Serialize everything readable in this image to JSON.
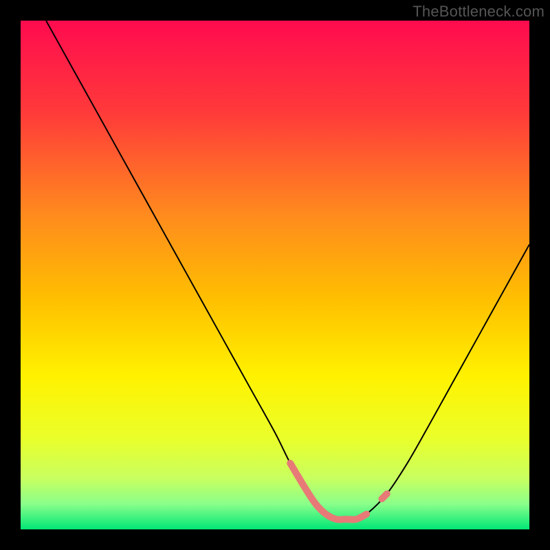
{
  "watermark": "TheBottleneck.com",
  "chart_data": {
    "type": "line",
    "title": "",
    "xlabel": "",
    "ylabel": "",
    "xlim": [
      0,
      100
    ],
    "ylim": [
      0,
      100
    ],
    "grid": false,
    "legend": false,
    "background_gradient_stops": [
      {
        "offset": 0.0,
        "color": "#ff0b4f"
      },
      {
        "offset": 0.18,
        "color": "#ff3a3a"
      },
      {
        "offset": 0.38,
        "color": "#ff8a1e"
      },
      {
        "offset": 0.55,
        "color": "#ffc000"
      },
      {
        "offset": 0.7,
        "color": "#fff200"
      },
      {
        "offset": 0.82,
        "color": "#eaff2a"
      },
      {
        "offset": 0.9,
        "color": "#c8ff60"
      },
      {
        "offset": 0.95,
        "color": "#8aff8a"
      },
      {
        "offset": 1.0,
        "color": "#00e676"
      }
    ],
    "series": [
      {
        "name": "mismatch-curve",
        "stroke": "#000000",
        "stroke_width": 2,
        "x": [
          5,
          10,
          15,
          20,
          25,
          30,
          35,
          40,
          45,
          50,
          53,
          56,
          58,
          60,
          62,
          64,
          66,
          68,
          72,
          76,
          80,
          85,
          90,
          95,
          100
        ],
        "y": [
          100,
          91,
          82,
          73,
          64,
          55,
          46,
          37,
          28,
          19,
          13,
          8,
          5,
          3,
          2,
          2,
          2,
          3,
          7,
          13,
          20,
          29,
          38,
          47,
          56
        ]
      },
      {
        "name": "near-zero-highlight",
        "stroke": "#e77a77",
        "stroke_width": 10,
        "stroke_linecap": "round",
        "x": [
          53,
          56,
          58,
          60,
          62,
          64,
          66,
          68
        ],
        "y": [
          13,
          8,
          5,
          3,
          2,
          2,
          2,
          3
        ]
      },
      {
        "name": "highlight-dot",
        "stroke": "#e77a77",
        "stroke_width": 10,
        "stroke_linecap": "round",
        "x": [
          71,
          72
        ],
        "y": [
          6,
          7
        ]
      }
    ]
  }
}
